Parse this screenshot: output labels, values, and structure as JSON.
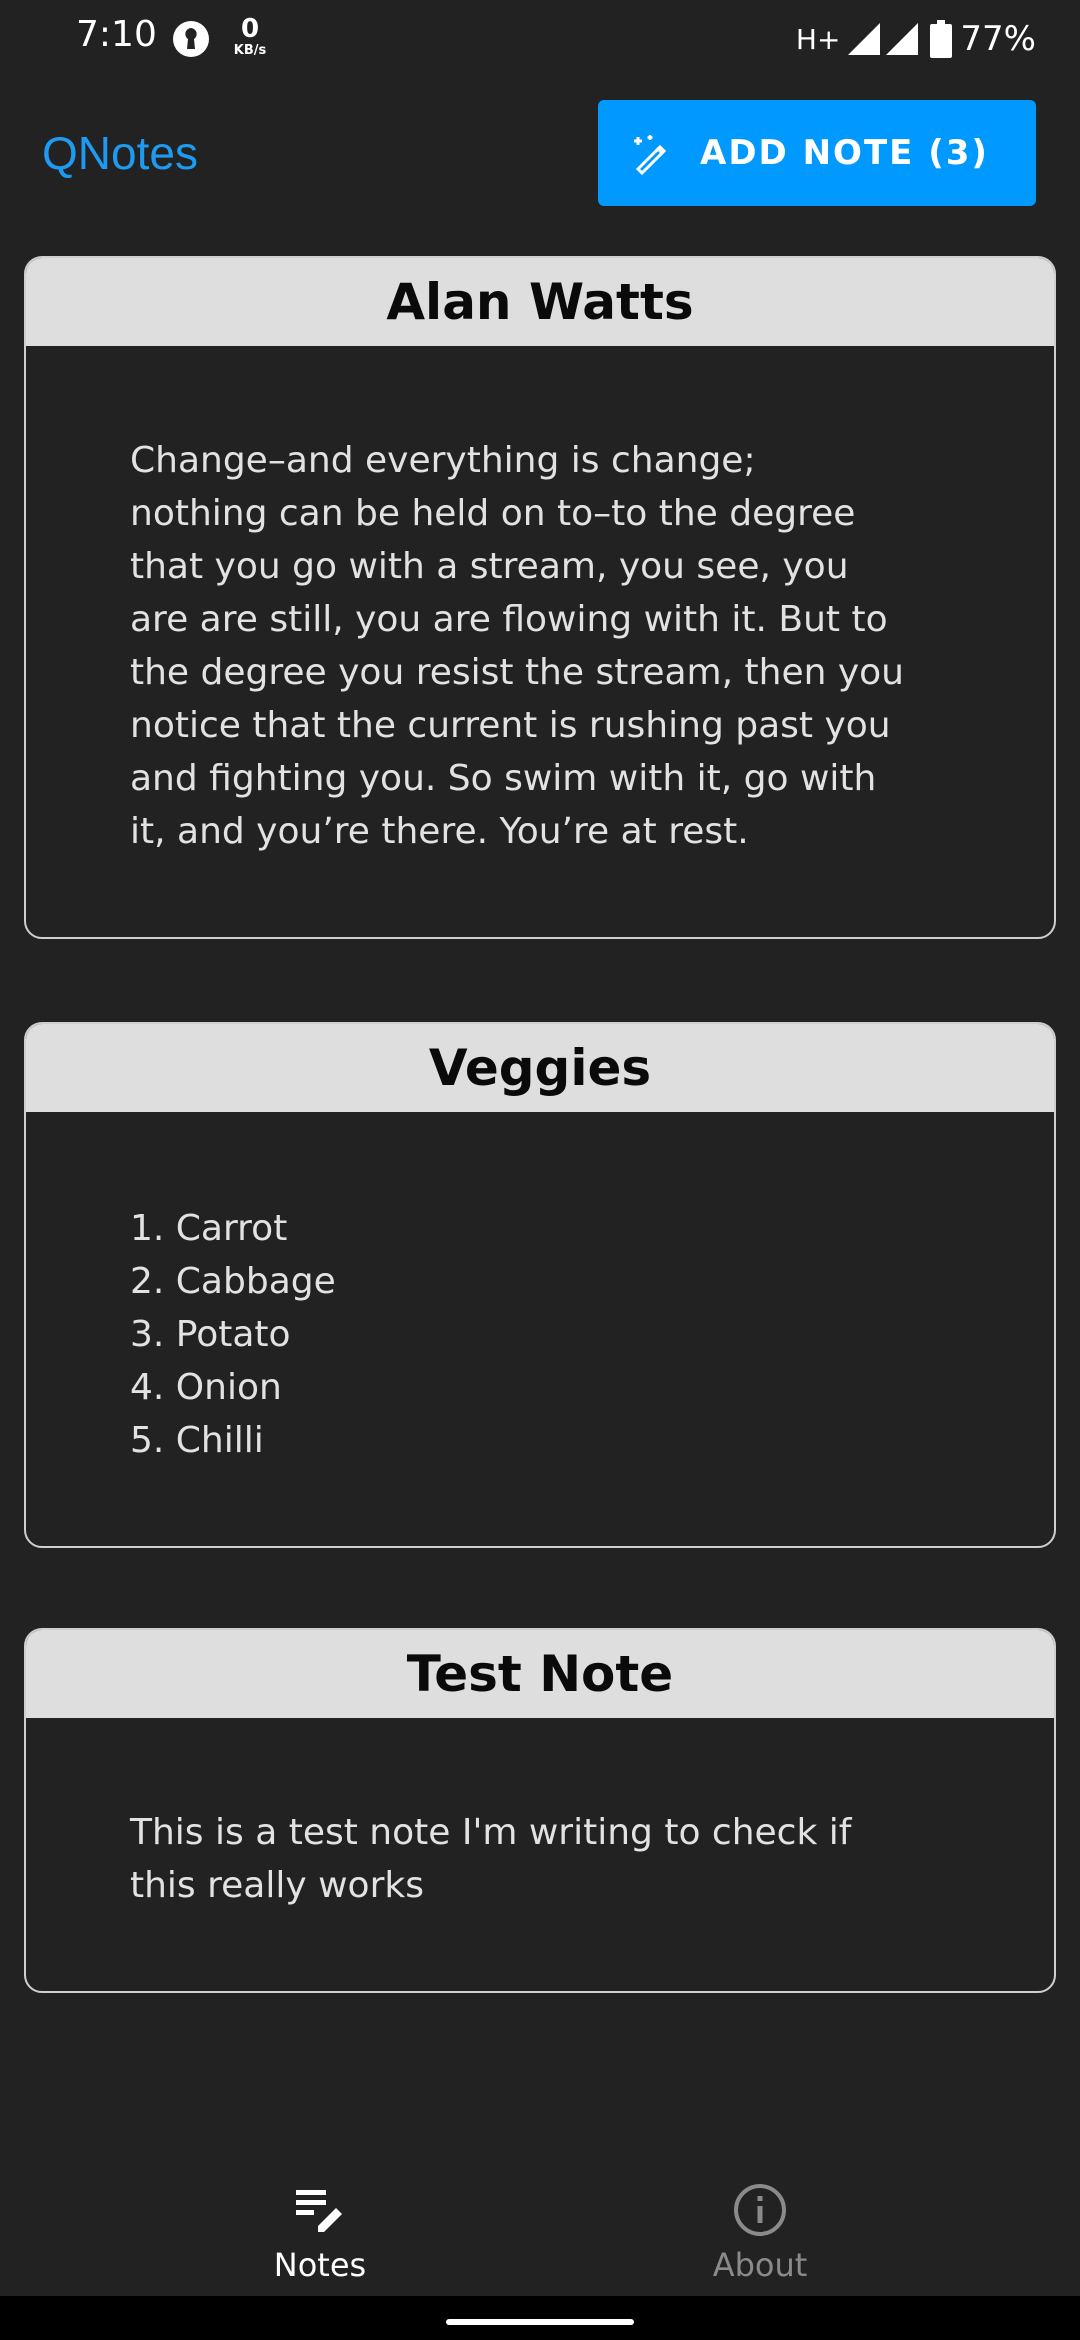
{
  "status_bar": {
    "time": "7:10",
    "net_speed_value": "0",
    "net_speed_unit": "KB/s",
    "network_type": "H+",
    "battery_percent": "77%"
  },
  "app_bar": {
    "title": "QNotes",
    "add_button_label": "ADD NOTE (3)",
    "accent_color": "#0099ff"
  },
  "notes": [
    {
      "title": "Alan Watts",
      "body": "Change–and everything is change;\nnothing can be held on to–to the degree\nthat you go with a stream, you see, you\nare are still, you are flowing with it. But to\nthe degree you resist the stream, then you\nnotice that the current is rushing past you\nand fighting you. So swim with it, go with\nit, and you’re there. You’re at rest."
    },
    {
      "title": "Veggies",
      "body": "1. Carrot\n2. Cabbage\n3. Potato\n4. Onion\n5. Chilli"
    },
    {
      "title": "Test Note",
      "body": "This is a test note I'm writing to check if\nthis really works"
    }
  ],
  "bottom_nav": {
    "items": [
      {
        "label": "Notes",
        "icon": "notes-edit-icon",
        "active": true
      },
      {
        "label": "About",
        "icon": "info-icon",
        "active": false
      }
    ]
  }
}
